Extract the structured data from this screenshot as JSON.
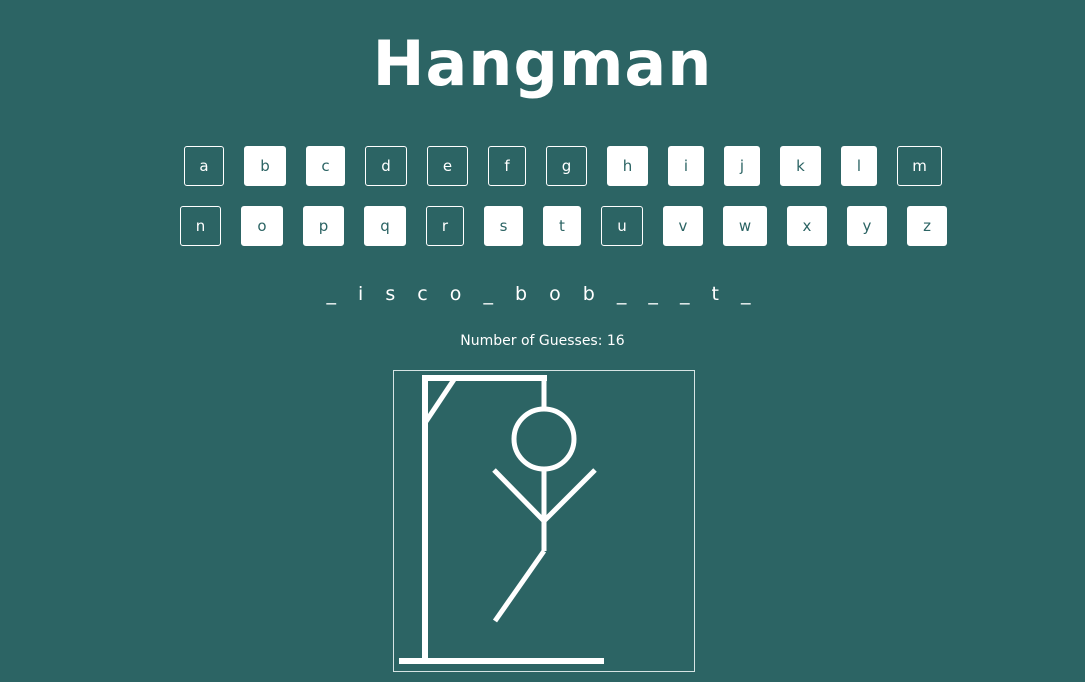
{
  "title": "Hangman",
  "alphabet": {
    "row1": [
      {
        "letter": "a",
        "used": true
      },
      {
        "letter": "b",
        "used": false
      },
      {
        "letter": "c",
        "used": false
      },
      {
        "letter": "d",
        "used": true
      },
      {
        "letter": "e",
        "used": true
      },
      {
        "letter": "f",
        "used": true
      },
      {
        "letter": "g",
        "used": true
      },
      {
        "letter": "h",
        "used": false
      },
      {
        "letter": "i",
        "used": false
      },
      {
        "letter": "j",
        "used": false
      },
      {
        "letter": "k",
        "used": false
      },
      {
        "letter": "l",
        "used": false
      },
      {
        "letter": "m",
        "used": true
      }
    ],
    "row2": [
      {
        "letter": "n",
        "used": true
      },
      {
        "letter": "o",
        "used": false
      },
      {
        "letter": "p",
        "used": false
      },
      {
        "letter": "q",
        "used": false
      },
      {
        "letter": "r",
        "used": true
      },
      {
        "letter": "s",
        "used": false
      },
      {
        "letter": "t",
        "used": false
      },
      {
        "letter": "u",
        "used": true
      },
      {
        "letter": "v",
        "used": false
      },
      {
        "letter": "w",
        "used": false
      },
      {
        "letter": "x",
        "used": false
      },
      {
        "letter": "y",
        "used": false
      },
      {
        "letter": "z",
        "used": false
      }
    ]
  },
  "word_display": "_ i s c o _ b o b _ _ _ t _",
  "guesses_text": "Number of Guesses: 16",
  "colors": {
    "background": "#2c6464",
    "foreground": "#ffffff"
  }
}
